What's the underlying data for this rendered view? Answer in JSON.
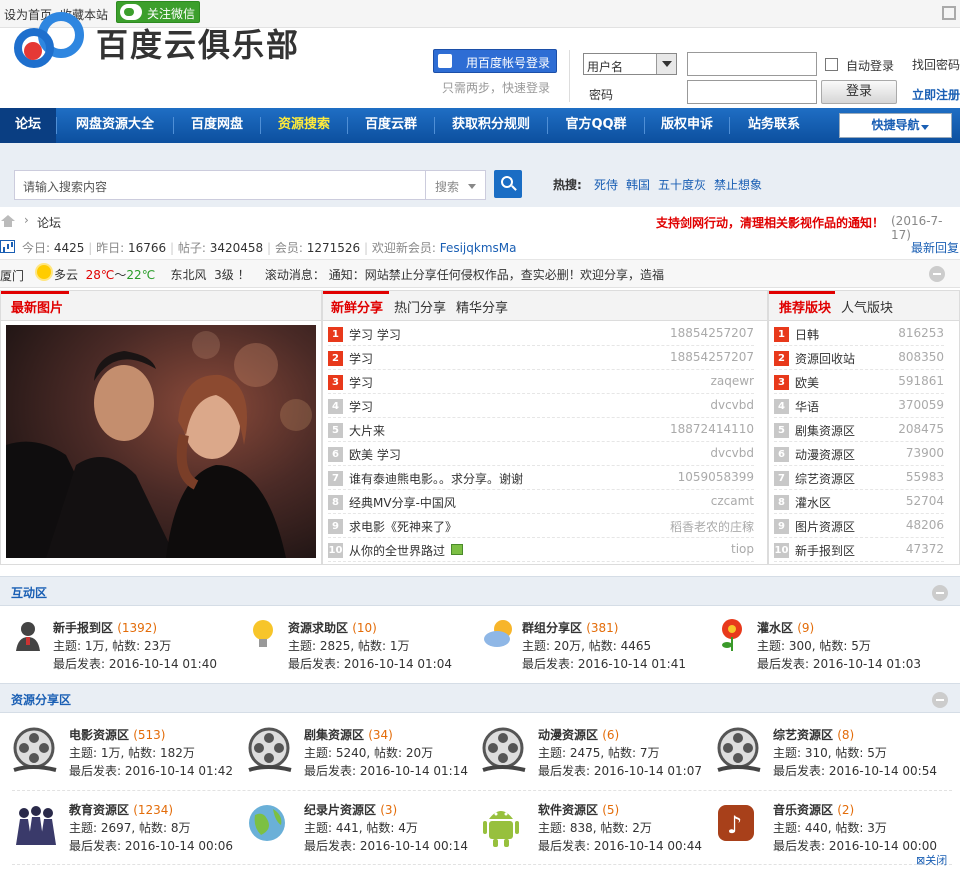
{
  "topbar": {
    "set_home": "设为首页",
    "bookmark": "收藏本站",
    "wechat": "关注微信"
  },
  "header": {
    "logo_text": "百度云俱乐部",
    "baidu_login": "用百度帐号登录",
    "baidu_sub": "只需两步，快速登录",
    "user_select": "用户名",
    "pwd_label": "密码",
    "auto_login": "自动登录",
    "login_btn": "登录",
    "find_pwd": "找回密码",
    "register": "立即注册"
  },
  "nav": {
    "items": [
      "论坛",
      "网盘资源大全",
      "百度网盘",
      "资源搜索",
      "百度云群",
      "获取积分规则",
      "官方QQ群",
      "版权申诉",
      "站务联系"
    ],
    "quick": "快捷导航"
  },
  "search": {
    "placeholder": "请输入搜索内容",
    "type": "搜索",
    "hot_label": "热搜:",
    "hot": [
      "死侍",
      "韩国",
      "五十度灰",
      "禁止想象"
    ]
  },
  "crumb": {
    "label": "论坛",
    "notice": "支持剑网行动，清理相关影视作品的通知！",
    "notice_date": "(2016-7-17)"
  },
  "stats": {
    "today_lbl": "今日:",
    "today": "4425",
    "yest_lbl": "昨日:",
    "yest": "16766",
    "posts_lbl": "帖子:",
    "posts": "3420458",
    "members_lbl": "会员:",
    "members": "1271526",
    "welcome": "欢迎新会员:",
    "new_member": "FesijqkmsMa",
    "latest": "最新回复"
  },
  "weather": {
    "city": "厦门",
    "cond": "多云",
    "low": "28℃",
    "sep": "～",
    "high": "22℃",
    "wind": "东北风",
    "level": "3级",
    "bang": "！",
    "scroll_lbl": "滚动消息：",
    "scroll": "通知：网站禁止分享任何侵权作品，查实必删！",
    "scroll2": "欢迎分享，造福"
  },
  "latest_pic": {
    "tab": "最新图片"
  },
  "fresh": {
    "tabs": [
      "新鲜分享",
      "热门分享",
      "精华分享"
    ],
    "rows": [
      {
        "n": "1",
        "t": "学习 学习",
        "u": "18854257207"
      },
      {
        "n": "2",
        "t": "学习",
        "u": "18854257207"
      },
      {
        "n": "3",
        "t": "学习",
        "u": "zaqewr"
      },
      {
        "n": "4",
        "t": "学习",
        "u": "dvcvbd"
      },
      {
        "n": "5",
        "t": "大片来",
        "u": "18872414110"
      },
      {
        "n": "6",
        "t": "欧美 学习",
        "u": "dvcvbd"
      },
      {
        "n": "7",
        "t": "谁有泰迪熊电影。。求分享。谢谢",
        "u": "1059058399"
      },
      {
        "n": "8",
        "t": "经典MV分享-中国风",
        "u": "czcamt"
      },
      {
        "n": "9",
        "t": "求电影《死神来了》",
        "u": "稻香老农的庄稼"
      },
      {
        "n": "10",
        "t": "从你的全世界路过",
        "u": "tiop"
      }
    ]
  },
  "boards": {
    "tabs": [
      "推荐版块",
      "人气版块"
    ],
    "rows": [
      {
        "n": "1",
        "t": "日韩",
        "v": "816253"
      },
      {
        "n": "2",
        "t": "资源回收站",
        "v": "808350"
      },
      {
        "n": "3",
        "t": "欧美",
        "v": "591861"
      },
      {
        "n": "4",
        "t": "华语",
        "v": "370059"
      },
      {
        "n": "5",
        "t": "剧集资源区",
        "v": "208475"
      },
      {
        "n": "6",
        "t": "动漫资源区",
        "v": "73900"
      },
      {
        "n": "7",
        "t": "综艺资源区",
        "v": "55983"
      },
      {
        "n": "8",
        "t": "灌水区",
        "v": "52704"
      },
      {
        "n": "9",
        "t": "图片资源区",
        "v": "48206"
      },
      {
        "n": "10",
        "t": "新手报到区",
        "v": "47372"
      }
    ]
  },
  "interact": {
    "title": "互动区",
    "forums": [
      {
        "name": "新手报到区",
        "count": "(1392)",
        "topics": "主题: 1万, 帖数: 23万",
        "last": "最后发表: 2016-10-14 01:40",
        "icon": "user-icon"
      },
      {
        "name": "资源求助区",
        "count": "(10)",
        "topics": "主题: 2825, 帖数: 1万",
        "last": "最后发表: 2016-10-14 01:04",
        "icon": "bulb-icon"
      },
      {
        "name": "群组分享区",
        "count": "(381)",
        "topics": "主题: 20万, 帖数: 4465",
        "last": "最后发表: 2016-10-14 01:41",
        "icon": "weather-icon"
      },
      {
        "name": "灌水区",
        "count": "(9)",
        "topics": "主题: 300, 帖数: 5万",
        "last": "最后发表: 2016-10-14 01:03",
        "icon": "flower-icon"
      }
    ]
  },
  "resources": {
    "title": "资源分享区",
    "forums": [
      {
        "name": "电影资源区",
        "count": "(513)",
        "topics": "主题: 1万, 帖数: 182万",
        "last": "最后发表: 2016-10-14 01:42",
        "icon": "film-reel-icon"
      },
      {
        "name": "剧集资源区",
        "count": "(34)",
        "topics": "主题: 5240, 帖数: 20万",
        "last": "最后发表: 2016-10-14 01:14",
        "icon": "film-reel-icon"
      },
      {
        "name": "动漫资源区",
        "count": "(6)",
        "topics": "主题: 2475, 帖数: 7万",
        "last": "最后发表: 2016-10-14 01:07",
        "icon": "film-reel-icon"
      },
      {
        "name": "综艺资源区",
        "count": "(8)",
        "topics": "主题: 310, 帖数: 5万",
        "last": "最后发表: 2016-10-14 00:54",
        "icon": "film-reel-icon"
      },
      {
        "name": "教育资源区",
        "count": "(1234)",
        "topics": "主题: 2697, 帖数: 8万",
        "last": "最后发表: 2016-10-14 00:06",
        "icon": "graduates-icon"
      },
      {
        "name": "纪录片资源区",
        "count": "(3)",
        "topics": "主题: 441, 帖数: 4万",
        "last": "最后发表: 2016-10-14 00:14",
        "icon": "globe-icon"
      },
      {
        "name": "软件资源区",
        "count": "(5)",
        "topics": "主题: 838, 帖数: 2万",
        "last": "最后发表: 2016-10-14 00:44",
        "icon": "android-icon"
      },
      {
        "name": "音乐资源区",
        "count": "(2)",
        "topics": "主题: 440, 帖数: 3万",
        "last": "最后发表: 2016-10-14 00:00",
        "icon": "music-icon"
      }
    ]
  },
  "close": "关闭"
}
